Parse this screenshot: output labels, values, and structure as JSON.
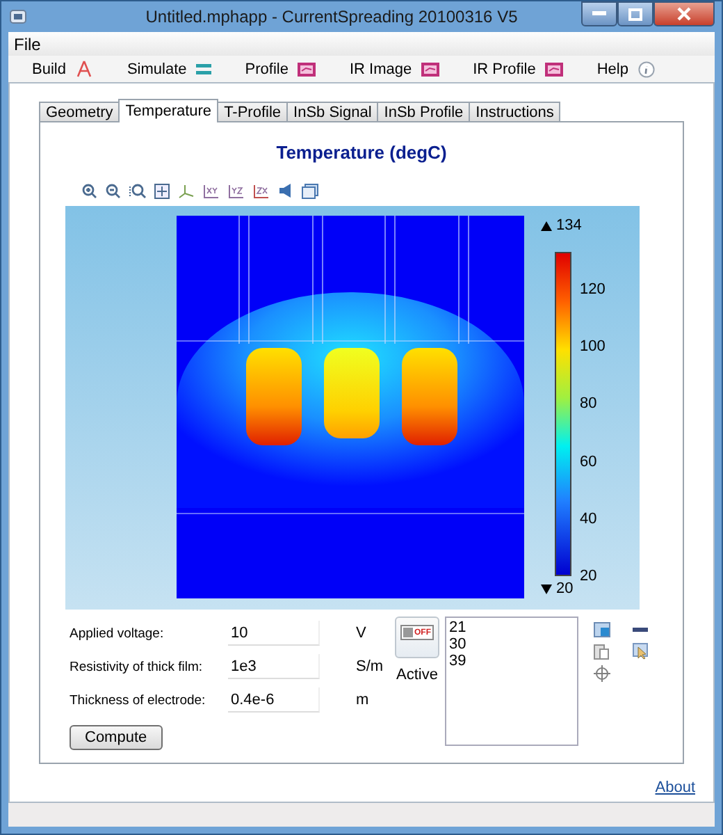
{
  "window": {
    "title": "Untitled.mphapp - CurrentSpreading 20100316 V5"
  },
  "menu": [
    {
      "label": "File"
    }
  ],
  "toolbar": [
    {
      "label": "Build",
      "kind": "build"
    },
    {
      "label": "Simulate",
      "kind": "simulate"
    },
    {
      "label": "Profile",
      "kind": "plot"
    },
    {
      "label": "IR Image",
      "kind": "image"
    },
    {
      "label": "IR Profile",
      "kind": "plot"
    },
    {
      "label": "Help",
      "kind": "help"
    }
  ],
  "tabs": [
    {
      "label": "Geometry",
      "selected": false
    },
    {
      "label": "Temperature",
      "selected": true
    },
    {
      "label": "T-Profile",
      "selected": false
    },
    {
      "label": "InSb Signal",
      "selected": false
    },
    {
      "label": "InSb Profile",
      "selected": false
    },
    {
      "label": "Instructions",
      "selected": false
    }
  ],
  "plot": {
    "title": "Temperature (degC)",
    "max_label": "134",
    "min_label": "20",
    "colorbar_ticks": [
      "120",
      "100",
      "80",
      "60",
      "40",
      "20"
    ]
  },
  "fields": [
    {
      "label": "Applied voltage:",
      "value": "10",
      "unit": "V"
    },
    {
      "label": "Resistivity of thick film:",
      "value": "1e3",
      "unit": "S/m"
    },
    {
      "label": "Thickness of electrode:",
      "value": "0.4e-6",
      "unit": "m"
    }
  ],
  "toggle": {
    "on": false,
    "state_label": "OFF",
    "label": "Active"
  },
  "results": [
    "21",
    "30",
    "39"
  ],
  "compute_button": "Compute",
  "about_link": "About"
}
